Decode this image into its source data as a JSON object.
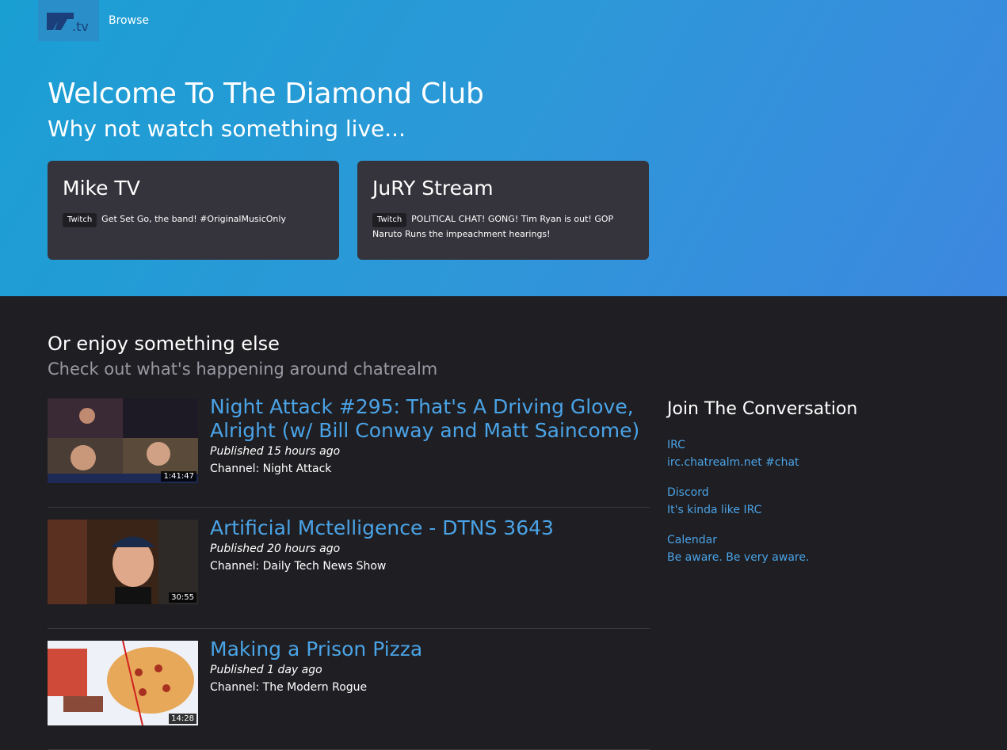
{
  "header": {
    "logo_text": ".tv",
    "nav": [
      "Browse"
    ]
  },
  "hero": {
    "title": "Welcome To The Diamond Club",
    "subtitle": "Why not watch something live...",
    "streams": [
      {
        "name": "Mike TV",
        "platform": "Twitch",
        "description": "Get Set Go, the band! #OriginalMusicOnly"
      },
      {
        "name": "JuRY Stream",
        "platform": "Twitch",
        "description": "POLITICAL CHAT! GONG! Tim Ryan is out! GOP Naruto Runs the impeachment hearings!"
      }
    ]
  },
  "main": {
    "title": "Or enjoy something else",
    "subtitle": "Check out what's happening around chatrealm",
    "videos": [
      {
        "title": "Night Attack #295: That's A Driving Glove, Alright (w/ Bill Conway and Matt Saincome)",
        "published": "Published 15 hours ago",
        "channel": "Channel: Night Attack",
        "duration": "1:41:47"
      },
      {
        "title": "Artificial Mctelligence - DTNS 3643",
        "published": "Published 20 hours ago",
        "channel": "Channel: Daily Tech News Show",
        "duration": "30:55"
      },
      {
        "title": "Making a Prison Pizza",
        "published": "Published 1 day ago",
        "channel": "Channel: The Modern Rogue",
        "duration": "14:28"
      }
    ]
  },
  "sidebar": {
    "title": "Join The Conversation",
    "groups": [
      {
        "name": "IRC",
        "detail": "irc.chatrealm.net #chat"
      },
      {
        "name": "Discord",
        "detail": "It's kinda like IRC"
      },
      {
        "name": "Calendar",
        "detail": "Be aware. Be very aware."
      }
    ]
  },
  "colors": {
    "link": "#4aa3e6",
    "hero_gradient_start": "#1a9fd3",
    "hero_gradient_end": "#3d87e0",
    "card": "#35343c",
    "background": "#1f1e22"
  }
}
